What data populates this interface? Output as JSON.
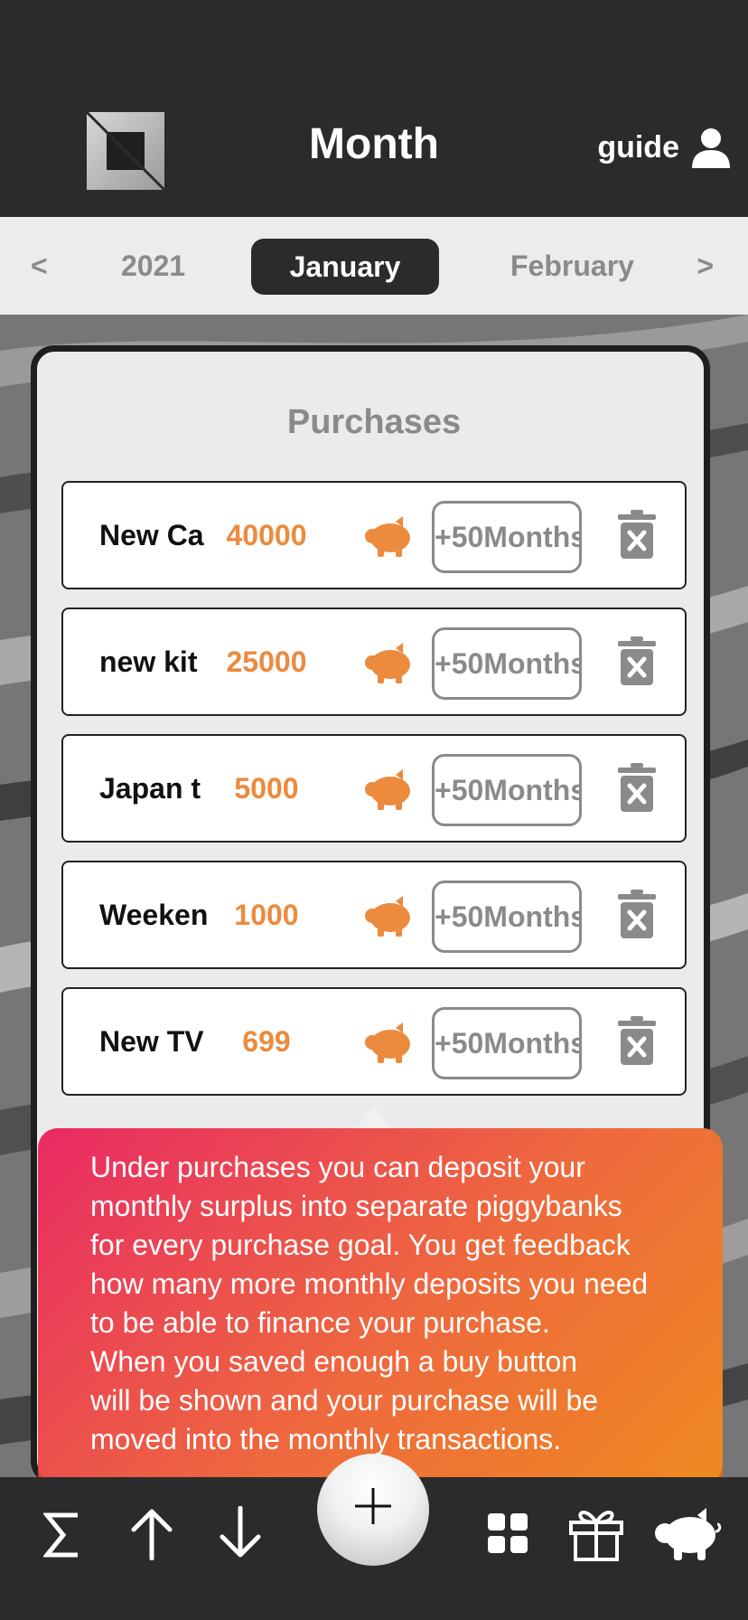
{
  "header": {
    "title": "Month",
    "guide_label": "guide"
  },
  "month_nav": {
    "prev": "<",
    "year": "2021",
    "selected": "January",
    "next_month": "February",
    "next": ">"
  },
  "purchases": {
    "title": "Purchases",
    "rows": [
      {
        "name": "New Ca",
        "amount": "40000",
        "months": "+50Months"
      },
      {
        "name": "new kit",
        "amount": "25000",
        "months": "+50Months"
      },
      {
        "name": "Japan t",
        "amount": "5000",
        "months": "+50Months"
      },
      {
        "name": "Weeken",
        "amount": "1000",
        "months": "+50Months"
      },
      {
        "name": "New TV",
        "amount": "699",
        "months": "+50Months"
      }
    ]
  },
  "tooltip": {
    "lines": [
      "Under purchases you can deposit your",
      "monthly surplus into separate piggybanks",
      "for every purchase goal. You get feedback",
      "how many more monthly deposits you need",
      "to be able to finance your purchase.",
      "When you saved enough a buy button",
      "will be shown and your purchase will be",
      "moved into the monthly transactions."
    ]
  },
  "bottom_bar": {
    "icons": [
      "sum-icon",
      "arrow-up-icon",
      "arrow-down-icon",
      "plus-icon",
      "grid-icon",
      "gift-icon",
      "piggy-bank-icon"
    ]
  },
  "colors": {
    "dark": "#2b2b2b",
    "accent_orange": "#ec8a3e",
    "muted_gray": "#8a8a8a",
    "panel": "#ebebeb",
    "tooltip_start": "#e92a64",
    "tooltip_end": "#ef8a1f"
  }
}
